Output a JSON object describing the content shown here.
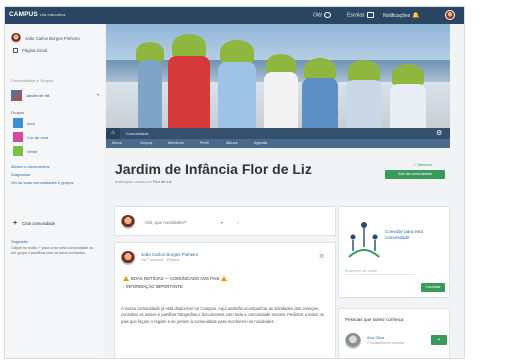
{
  "topbar": {
    "brand": "CAMPUS",
    "brand_sub": "vila educativa",
    "items": [
      "Olá!",
      "Escolas",
      "Notificações"
    ]
  },
  "sidebar": {
    "user_name": "João Carlos Borges Pinheiro",
    "mural_label": "Página inicial",
    "section_heading": "Comunidades e Grupos",
    "community_label": "Jardim de Inf.",
    "groups_heading": "Grupos",
    "groups": [
      {
        "label": "Azul",
        "color": "#3c8fd0"
      },
      {
        "label": "Cor-de-rosa",
        "color": "#d14ba3"
      },
      {
        "label": "Verde",
        "color": "#7bbf4a"
      }
    ],
    "links": [
      "Álbuns e documentos",
      "Diagramas",
      "Ver as suas comunidades e grupos"
    ],
    "join_label": "Criar comunidade",
    "note_title": "Sugestão",
    "note_text": "Clique no botão + para criar uma comunidade ou um grupo e partilhar com os seus contactos."
  },
  "cover": {
    "breadcrumb": "Comunidade",
    "tabs": [
      "Mural",
      "Grupos",
      "Membros",
      "Perfil",
      "Álbuns",
      "Agenda"
    ]
  },
  "header": {
    "title": "Jardim de Infância Flor de Liz",
    "subtitle_prefix": "Instituição criada por ",
    "subtitle_link": "Flor de Liz",
    "member_label": "✓ Membro",
    "member_button": "Sair da comunidade"
  },
  "postbox": {
    "prompt": "Olá, que novidades?",
    "dropdown": "▾"
  },
  "post": {
    "author": "João Carlos Borges Pinheiro",
    "meta": "Há 7 minutos · Pública",
    "notice_line_1": "BOAS NOTÍCIAS — COMUNICADO AOS PAIS",
    "notice_line_2": "INFORMAÇÃO IMPORTANTE",
    "paragraph": "A nossa comunidade já está disponível no Campus. Aqui poderão acompanhar as atividades das crianças, consultar os avisos e partilhar fotografias e documentos com toda a comunidade escolar. Pedimos a todos os pais que façam o registo e se juntem à comunidade para receberem as novidades."
  },
  "invite": {
    "text": "Convidar para esta comunidade",
    "input_placeholder": "Endereço de email",
    "button": "Convidar"
  },
  "people": {
    "title": "Pessoas que talvez conheça",
    "name": "Ana Silva",
    "sub": "2 contactos em comum",
    "button": "+"
  },
  "colors": {
    "topbar": "#2b4662",
    "accent_green": "#3a9a5c",
    "link_blue": "#2b6ba5",
    "hat_green": "#8fb63e"
  }
}
